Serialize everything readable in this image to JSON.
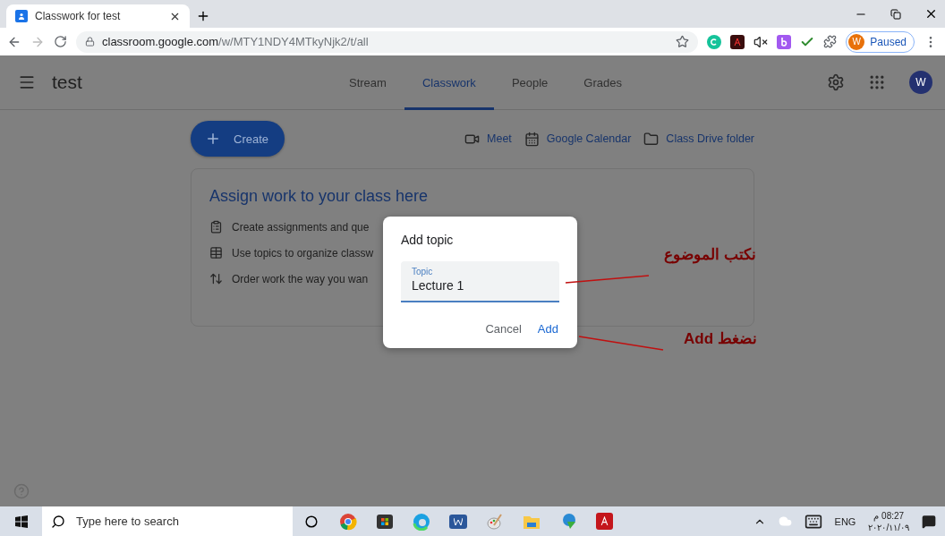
{
  "browser": {
    "tab_title": "Classwork for test",
    "url_host": "classroom.google.com",
    "url_path": "/w/MTY1NDY4MTkyNjk2/t/all",
    "profile": {
      "initial": "W",
      "label": "Paused"
    }
  },
  "app": {
    "class_name": "test",
    "account_initial": "W",
    "nav_tabs": [
      {
        "label": "Stream",
        "selected": false
      },
      {
        "label": "Classwork",
        "selected": true
      },
      {
        "label": "People",
        "selected": false
      },
      {
        "label": "Grades",
        "selected": false
      }
    ]
  },
  "toolbar": {
    "create_label": "Create",
    "links": [
      {
        "kind": "video",
        "label": "Meet"
      },
      {
        "kind": "calendar",
        "label": "Google Calendar"
      },
      {
        "kind": "folder",
        "label": "Class Drive folder"
      }
    ]
  },
  "empty_state": {
    "title": "Assign work to your class here",
    "tips": [
      {
        "kind": "clipboard",
        "text": "Create assignments and que"
      },
      {
        "kind": "table",
        "text": "Use topics to organize classw"
      },
      {
        "kind": "reorder",
        "text": "Order work the way you wan"
      }
    ]
  },
  "dialog": {
    "title": "Add topic",
    "field": {
      "label": "Topic",
      "value": "Lecture 1"
    },
    "buttons": [
      {
        "kind": "cancel",
        "label": "Cancel"
      },
      {
        "kind": "confirm",
        "label": "Add"
      }
    ]
  },
  "annotations": [
    {
      "text": "نكتب الموضوع"
    },
    {
      "text": "نضغط Add"
    }
  ],
  "taskbar": {
    "search_placeholder": "Type here to search",
    "language": "ENG",
    "time": "08:27 م",
    "date": "٢٠٢٠/١١/٠٩"
  }
}
